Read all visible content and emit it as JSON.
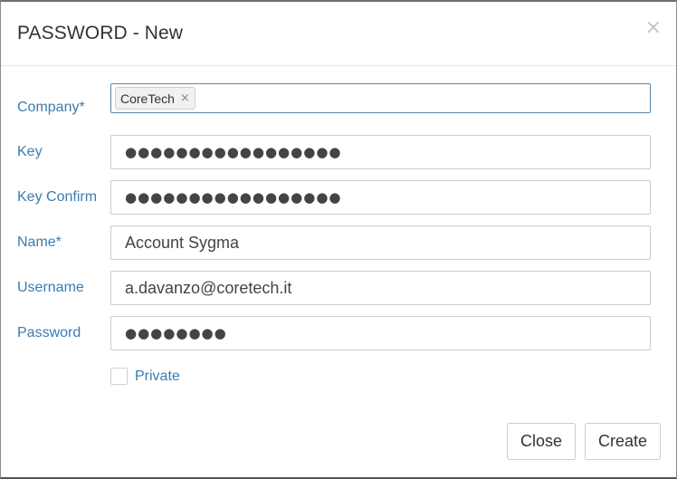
{
  "dialog": {
    "title": "PASSWORD - New",
    "close_glyph": "×"
  },
  "form": {
    "company": {
      "label": "Company*",
      "tag": "CoreTech",
      "tag_remove": "×"
    },
    "key": {
      "label": "Key",
      "value": "●●●●●●●●●●●●●●●●●"
    },
    "key_confirm": {
      "label": "Key Confirm",
      "value": "●●●●●●●●●●●●●●●●●"
    },
    "name": {
      "label": "Name*",
      "value": "Account Sygma"
    },
    "username": {
      "label": "Username",
      "value": "a.davanzo@coretech.it"
    },
    "password": {
      "label": "Password",
      "value": "●●●●●●●●"
    },
    "private": {
      "label": "Private",
      "checked": false
    }
  },
  "footer": {
    "close_label": "Close",
    "create_label": "Create"
  }
}
